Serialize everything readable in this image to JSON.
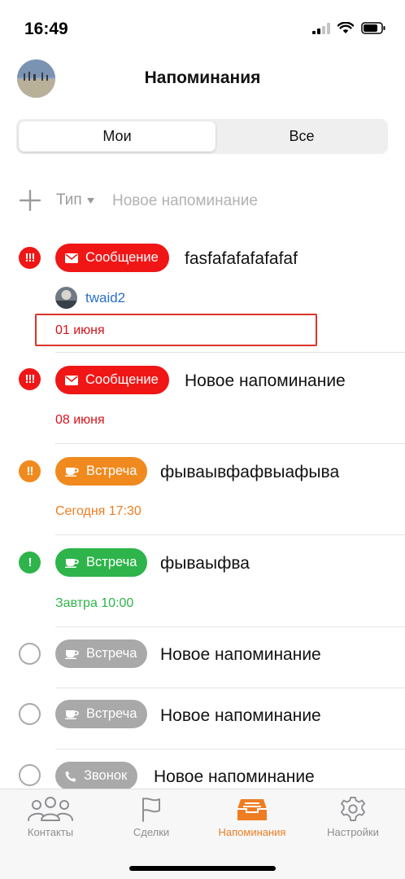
{
  "status_bar": {
    "time": "16:49"
  },
  "header": {
    "title": "Напоминания"
  },
  "segments": [
    {
      "label": "Мои"
    },
    {
      "label": "Все"
    }
  ],
  "add_row": {
    "type_label": "Тип",
    "placeholder": "Новое напоминание"
  },
  "colors": {
    "red": "#f01616",
    "orange": "#f08a1e",
    "green": "#2eb44a",
    "gray": "#a9a9a9",
    "accent": "#ee7d22",
    "link": "#2a6fc9"
  },
  "reminders": [
    {
      "priority": "!!!",
      "priority_color": "#f01616",
      "type_icon": "envelope-icon",
      "type": "Сообщение",
      "title": "fasfafafafafafaf",
      "owner": "twaid2",
      "due": "01 июня",
      "due_color": "#d6131b"
    },
    {
      "priority": "!!!",
      "priority_color": "#f01616",
      "type_icon": "envelope-icon",
      "type": "Сообщение",
      "title": "Новое напоминание",
      "due": "08 июня",
      "due_color": "#d6131b"
    },
    {
      "priority": "!!",
      "priority_color": "#f08a1e",
      "type_icon": "coffee-cup-icon",
      "type": "Встреча",
      "title": "фываывфафвыафыва",
      "due": "Сегодня 17:30",
      "due_color": "#ee7d22"
    },
    {
      "priority": "!",
      "priority_color": "#2eb44a",
      "type_icon": "coffee-cup-icon",
      "type": "Встреча",
      "title": "фываыфва",
      "due": "Завтра 10:00",
      "due_color": "#2eb44a"
    },
    {
      "priority": "",
      "type_icon": "coffee-cup-icon",
      "type": "Встреча",
      "title": "Новое напоминание"
    },
    {
      "priority": "",
      "type_icon": "coffee-cup-icon",
      "type": "Встреча",
      "title": "Новое напоминание"
    },
    {
      "priority": "",
      "type_icon": "phone-icon",
      "type": "Звонок",
      "title": "Новое напоминание"
    }
  ],
  "tabbar": {
    "items": [
      {
        "label": "Контакты",
        "icon": "contacts-icon",
        "active": false
      },
      {
        "label": "Сделки",
        "icon": "flag-icon",
        "active": false
      },
      {
        "label": "Напоминания",
        "icon": "inbox-tray-icon",
        "active": true
      },
      {
        "label": "Настройки",
        "icon": "gear-icon",
        "active": false
      }
    ]
  }
}
